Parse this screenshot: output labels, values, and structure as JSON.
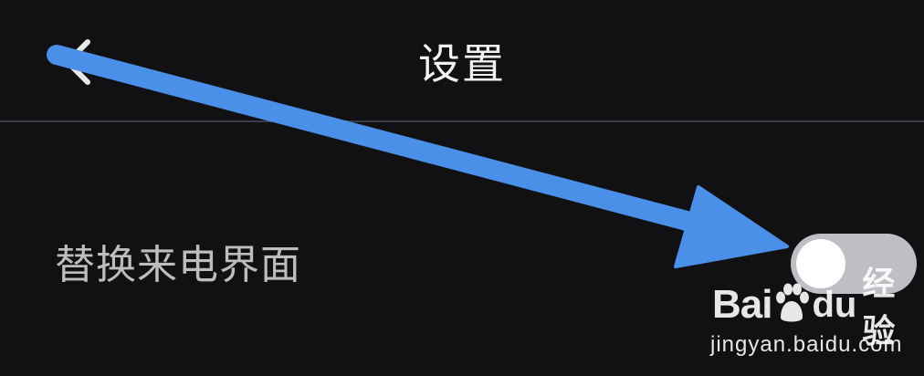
{
  "header": {
    "title": "设置",
    "back_icon": "chevron-left-icon"
  },
  "settings": {
    "items": [
      {
        "label": "替换来电界面",
        "toggle_on": false
      }
    ]
  },
  "annotation": {
    "arrow_icon": "arrow-icon",
    "arrow_color": "#4a8fe8"
  },
  "watermark": {
    "logo_text_bai": "Bai",
    "logo_text_du": "du",
    "logo_text_jingyan": "经验",
    "url": "jingyan.baidu.com"
  },
  "colors": {
    "background": "#111113",
    "divider": "#3c3c48",
    "toggle_track_off": "#bebec4",
    "label_text": "#bdbdbd",
    "title_text": "#f2f2f2"
  }
}
